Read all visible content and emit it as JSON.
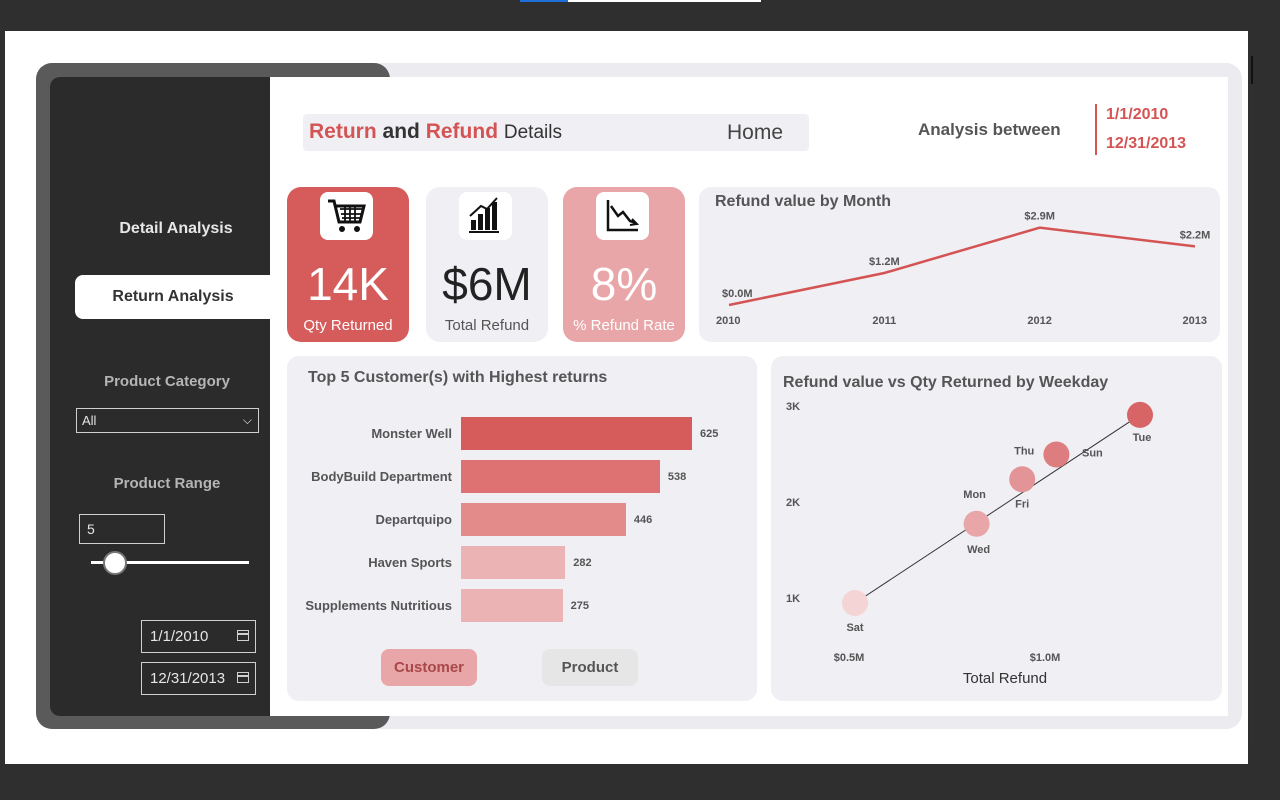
{
  "colors": {
    "accent": "#d45454",
    "panel": "#efeff4",
    "sidebar": "#2b2b2b"
  },
  "header": {
    "title_part1": "Return",
    "title_and": "and",
    "title_part2": "Refund",
    "title_part3": "Details",
    "home_label": "Home",
    "analysis_label": "Analysis between",
    "date_start": "1/1/2010",
    "date_end": "12/31/2013"
  },
  "sidebar": {
    "nav_detail": "Detail Analysis",
    "nav_return": "Return Analysis",
    "category_label": "Product Category",
    "category_value": "All",
    "range_label": "Product Range",
    "range_value": "5",
    "slider_value": 5,
    "date_from": "1/1/2010",
    "date_to": "12/31/2013"
  },
  "kpis": [
    {
      "value": "14K",
      "caption": "Qty Returned",
      "icon": "shopping-cart-icon"
    },
    {
      "value": "$6M",
      "caption": "Total Refund",
      "icon": "bar-chart-icon"
    },
    {
      "value": "8%",
      "caption": "% Refund Rate",
      "icon": "trend-down-icon"
    }
  ],
  "toggles": {
    "customer": "Customer",
    "product": "Product"
  },
  "chart_data": [
    {
      "type": "line",
      "title": "Refund value by Month",
      "x": [
        "2010",
        "2011",
        "2012",
        "2013"
      ],
      "values": [
        0.0,
        1.2,
        2.9,
        2.2
      ],
      "data_labels": [
        "$0.0M",
        "$1.2M",
        "$2.9M",
        "$2.2M"
      ],
      "ylim": [
        0,
        3.0
      ]
    },
    {
      "type": "bar",
      "title": "Top 5 Customer(s) with Highest returns",
      "categories": [
        "Monster Well",
        "BodyBuild Department",
        "Departquipo",
        "Haven Sports",
        "Supplements Nutritious"
      ],
      "values": [
        625,
        538,
        446,
        282,
        275
      ]
    },
    {
      "type": "scatter",
      "title": "Refund value vs Qty Returned by Weekday",
      "xlabel": "Total Refund",
      "ylabel": "",
      "x_ticks": [
        "$0.5M",
        "$1.0M"
      ],
      "y_ticks": [
        "3K",
        "2K",
        "1K"
      ],
      "points": [
        {
          "label": "Sat",
          "x": 0.5,
          "y": 1.0
        },
        {
          "label": "Wed",
          "x": 0.82,
          "y": 1.8
        },
        {
          "label": "Mon",
          "x": 0.82,
          "y": 1.84
        },
        {
          "label": "Fri",
          "x": 0.94,
          "y": 2.25
        },
        {
          "label": "Thu",
          "x": 0.94,
          "y": 2.28
        },
        {
          "label": "Sun",
          "x": 1.03,
          "y": 2.5
        },
        {
          "label": "Tue",
          "x": 1.25,
          "y": 2.9
        }
      ]
    }
  ]
}
